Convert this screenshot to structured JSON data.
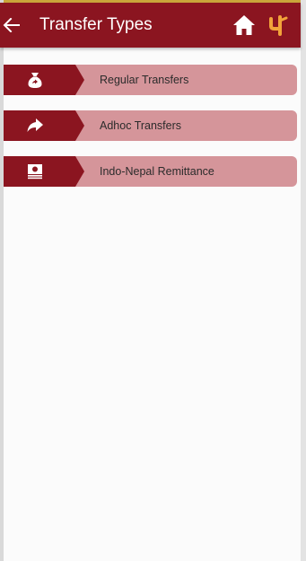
{
  "header": {
    "title": "Transfer Types",
    "back_icon": "arrow-left-icon",
    "home_icon": "home-icon",
    "logo_icon": "bank-logo-icon"
  },
  "colors": {
    "header_bg": "#8b1520",
    "badge_bg": "#8b1520",
    "item_bg": "#d5959a",
    "logo": "#f2a33a"
  },
  "items": [
    {
      "label": "Regular Transfers",
      "icon": "money-bag-icon"
    },
    {
      "label": "Adhoc Transfers",
      "icon": "share-arrow-icon"
    },
    {
      "label": "Indo-Nepal Remittance",
      "icon": "cash-icon"
    }
  ]
}
